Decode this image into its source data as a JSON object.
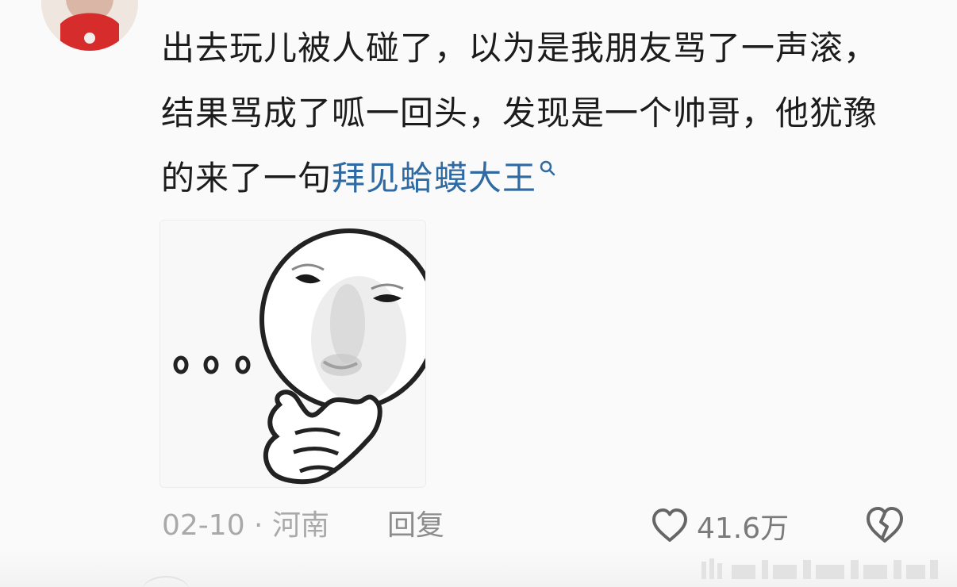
{
  "comment": {
    "text_main": "出去玩儿被人碰了，以为是我朋友骂了一声滚，结果骂成了呱一回头，发现是一个帅哥，他犹豫的来了一句",
    "topic_link": "拜见蛤蟆大王",
    "date": "02-10",
    "separator": " · ",
    "location": "河南",
    "reply_label": "回复",
    "like_count": "41.6万"
  },
  "icons": {
    "like": "heart-outline-icon",
    "dislike": "broken-heart-icon",
    "topic_search": "search-icon"
  },
  "colors": {
    "topic_link": "#2f6aa3",
    "meta_text": "#a9a9a9",
    "body_text": "#1c1c1c"
  }
}
